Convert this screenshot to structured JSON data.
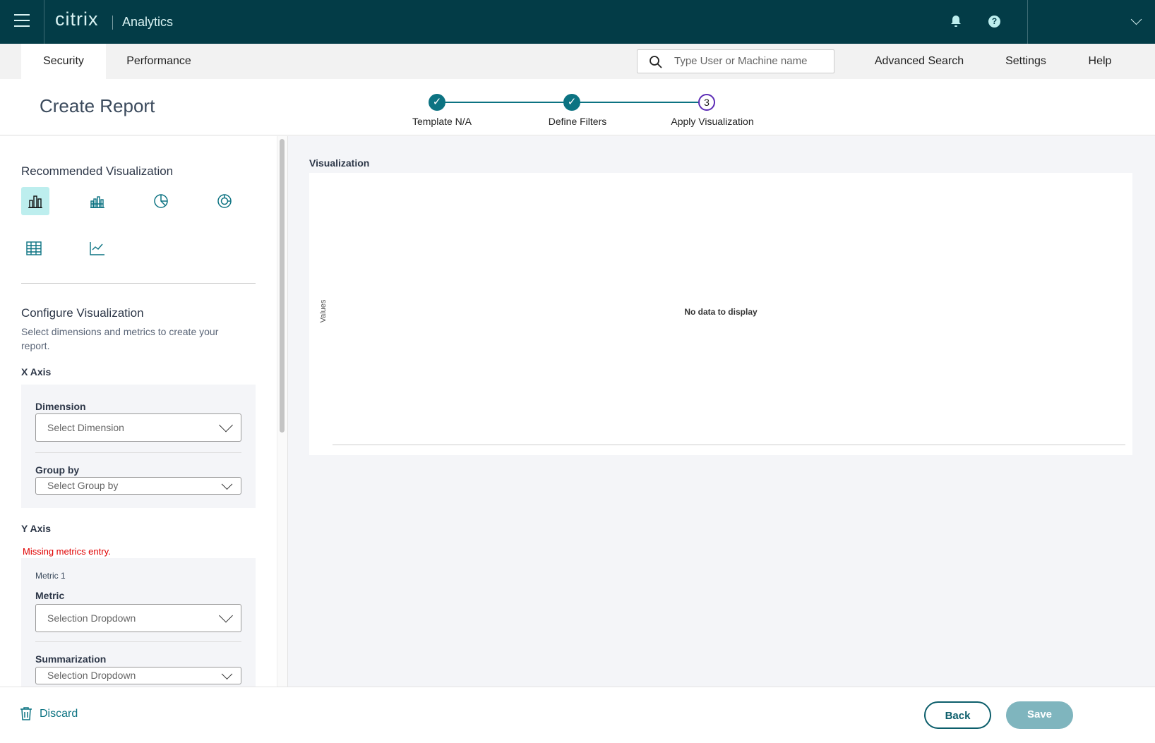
{
  "header": {
    "brand": "citrix",
    "product": "Analytics"
  },
  "nav": {
    "tabs": [
      {
        "label": "Security",
        "active": true
      },
      {
        "label": "Performance",
        "active": false
      }
    ],
    "search_placeholder": "Type User or Machine name",
    "links": [
      "Advanced Search",
      "Settings",
      "Help"
    ]
  },
  "page": {
    "title": "Create Report"
  },
  "stepper": {
    "steps": [
      {
        "label": "Template N/A",
        "state": "done"
      },
      {
        "label": "Define Filters",
        "state": "done"
      },
      {
        "label": "Apply Visualization",
        "number": "3",
        "state": "current"
      }
    ]
  },
  "left": {
    "recommended_title": "Recommended Visualization",
    "visualizations": [
      "bar-chart",
      "grouped-bar-chart",
      "pie-chart",
      "donut-chart",
      "table",
      "line-chart"
    ],
    "configure_title": "Configure Visualization",
    "configure_desc": "Select dimensions and metrics to create your report.",
    "x_axis": {
      "title": "X Axis",
      "dimension_label": "Dimension",
      "dimension_value": "Select Dimension",
      "groupby_label": "Group by",
      "groupby_value": "Select Group by"
    },
    "y_axis": {
      "title": "Y Axis",
      "error": "Missing metrics entry.",
      "metric_group": "Metric 1",
      "metric_label": "Metric",
      "metric_value": "Selection Dropdown",
      "summarization_label": "Summarization",
      "summarization_value": "Selection Dropdown"
    }
  },
  "main": {
    "title": "Visualization",
    "y_label": "Values",
    "empty": "No data to display"
  },
  "footer": {
    "discard": "Discard",
    "back": "Back",
    "save": "Save"
  },
  "colors": {
    "header": "#033c47",
    "accent": "#0c7382",
    "current_step": "#5b2bb5",
    "error": "#e00000",
    "save_disabled": "#7fb5be"
  }
}
